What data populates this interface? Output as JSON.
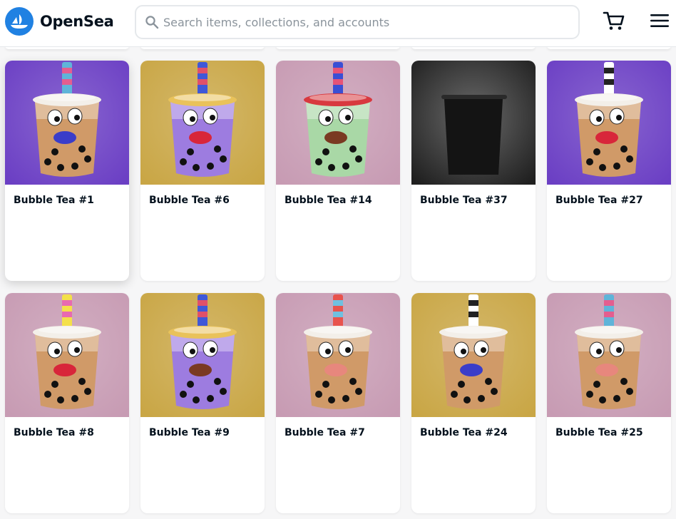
{
  "header": {
    "logo_text": "OpenSea",
    "search_placeholder": "Search items, collections, and accounts",
    "cart_icon": "cart-icon",
    "menu_icon": "hamburger-menu-icon",
    "accent_color": "#2081e2"
  },
  "items": [
    {
      "title": "Bubble Tea #1",
      "bg": "#6b3fc4",
      "liquid": "#d09a68",
      "lid": "#f3efe9",
      "straw": [
        "#5fb4d9",
        "#e45e8f"
      ],
      "mouth": "#3a3dc9"
    },
    {
      "title": "Bubble Tea #6",
      "bg": "#c9a645",
      "liquid": "#9d7ce0",
      "lid": "#e9c25a",
      "straw": [
        "#3f58d8",
        "#e0506a"
      ],
      "mouth": "#d8263a"
    },
    {
      "title": "Bubble Tea #14",
      "bg": "#c79bb3",
      "liquid": "#a9d8a6",
      "lid": "#d8393f",
      "straw": [
        "#3a4fd4",
        "#e65377"
      ],
      "mouth": "#7a3a22"
    },
    {
      "title": "Bubble Tea #37",
      "bg": "#1f1f1f",
      "liquid": "#121212",
      "lid": "#1a1a1a",
      "straw": [
        "#1a1a1a",
        "#1a1a1a"
      ],
      "mouth": "none"
    },
    {
      "title": "Bubble Tea #27",
      "bg": "#6b3fc4",
      "liquid": "#d09a68",
      "lid": "#f3efe9",
      "straw": [
        "#ffffff",
        "#222222"
      ],
      "mouth": "#d8263a"
    },
    {
      "title": "Bubble Tea #8",
      "bg": "#c79bb3",
      "liquid": "#d09a68",
      "lid": "#f3efe9",
      "straw": [
        "#f4e04a",
        "#e86ab0"
      ],
      "mouth": "#d8263a"
    },
    {
      "title": "Bubble Tea #9",
      "bg": "#c9a645",
      "liquid": "#9d7ce0",
      "lid": "#e9c25a",
      "straw": [
        "#3f58d8",
        "#e0506a"
      ],
      "mouth": "#7a3a22"
    },
    {
      "title": "Bubble Tea #7",
      "bg": "#c79bb3",
      "liquid": "#d09a68",
      "lid": "#f3efe9",
      "straw": [
        "#e8534d",
        "#6fc0e0"
      ],
      "mouth": "#e7877d"
    },
    {
      "title": "Bubble Tea #24",
      "bg": "#c9a645",
      "liquid": "#d09a68",
      "lid": "#f3efe9",
      "straw": [
        "#ffffff",
        "#222222"
      ],
      "mouth": "#3a3dc9"
    },
    {
      "title": "Bubble Tea #25",
      "bg": "#c79bb3",
      "liquid": "#d09a68",
      "lid": "#f3efe9",
      "straw": [
        "#5fb4d9",
        "#e45e8f"
      ],
      "mouth": "#e7877d"
    }
  ]
}
